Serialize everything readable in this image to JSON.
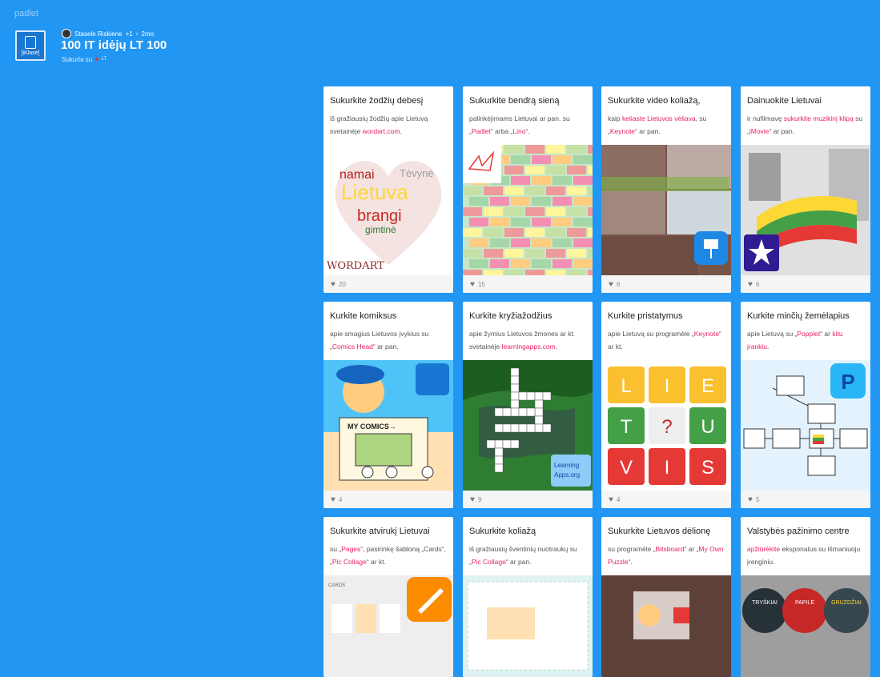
{
  "app": {
    "brand": "padlet"
  },
  "header": {
    "author": "Stasele Riskiene",
    "plus": "+1",
    "dot": "•",
    "age": "2mo",
    "title": "100 IT idėjų LT 100",
    "made_with": "Sukurta su",
    "made_lt": "LT",
    "logo_text": "[iKlasė]"
  },
  "colors": {
    "background": "#2196f3",
    "link": "#e91e63",
    "card": "#ffffff",
    "footer": "#f5f5f5"
  },
  "cards": [
    {
      "title": "Sukurkite žodžių debesį",
      "parts": [
        {
          "t": "iš gražiausių žodžių apie Lietuvą svetainėje "
        },
        {
          "t": "wordart.com",
          "link": true
        },
        {
          "t": "."
        }
      ],
      "likes": "20",
      "image": "lietuva-word-cloud-heart",
      "img_text": [
        "namai",
        "Tėvynė",
        "Lietuva",
        "brangi",
        "gimtinė",
        "WORDART"
      ]
    },
    {
      "title": "Sukurkite bendrą sieną",
      "parts": [
        {
          "t": "palinkėjimams Lietuvai ar pan. su „"
        },
        {
          "t": "Padlet",
          "link": true
        },
        {
          "t": "“ arba „"
        },
        {
          "t": "Lino",
          "link": true
        },
        {
          "t": "“."
        }
      ],
      "likes": "15",
      "image": "sticky-notes-wall",
      "img_text": []
    },
    {
      "title": "Sukurkite video koliažą,",
      "parts": [
        {
          "t": "kaip "
        },
        {
          "t": "keliaste Lietuvos vėliava",
          "link": true
        },
        {
          "t": ", su „"
        },
        {
          "t": "Keynote",
          "link": true
        },
        {
          "t": "“ ar pan."
        }
      ],
      "likes": "6",
      "image": "flag-photo-collage",
      "img_text": []
    },
    {
      "title": "Dainuokite Lietuvai",
      "parts": [
        {
          "t": "ir nufilmavę "
        },
        {
          "t": "sukurkite muzikinį klipą",
          "link": true
        },
        {
          "t": " su „"
        },
        {
          "t": "iMovie",
          "link": true
        },
        {
          "t": "“ ar pan."
        }
      ],
      "likes": "6",
      "image": "flag-ribbon-imovie",
      "img_text": []
    },
    {
      "title": "Kurkite komiksus",
      "parts": [
        {
          "t": "apie smagius Lietuvos įvykius su „"
        },
        {
          "t": "Comics Head",
          "link": true
        },
        {
          "t": "“ ar pan."
        }
      ],
      "likes": "4",
      "image": "comics-head-cartoon",
      "img_text": [
        "MY COMICS→"
      ]
    },
    {
      "title": "Kurkite kryžiažodžius",
      "parts": [
        {
          "t": "apie žymius Lietuvos žmones ar kt. svetainėje "
        },
        {
          "t": "learningapps.com",
          "link": true
        },
        {
          "t": "."
        }
      ],
      "likes": "9",
      "image": "crossword-lake",
      "img_text": [
        "Learning",
        "Apps.org"
      ]
    },
    {
      "title": "Kurkite pristatymus",
      "parts": [
        {
          "t": "apie Lietuvą su programėle „"
        },
        {
          "t": "Keynote",
          "link": true
        },
        {
          "t": "“ ar kt."
        }
      ],
      "likes": "4",
      "image": "lietuvis-tiles",
      "img_text": [
        "L",
        "I",
        "E",
        "T",
        "?",
        "U",
        "V",
        "I",
        "S"
      ]
    },
    {
      "title": "Kurkite minčių žemėlapius",
      "parts": [
        {
          "t": "apie Lietuvą su „"
        },
        {
          "t": "Popplet",
          "link": true
        },
        {
          "t": "“ ar "
        },
        {
          "t": "kitu įrankiu",
          "link": true
        },
        {
          "t": "."
        }
      ],
      "likes": "5",
      "image": "popplet-mind-map",
      "img_text": [
        "P"
      ]
    },
    {
      "title": "Sukurkite atvirukį Lietuvai",
      "parts": [
        {
          "t": "su „"
        },
        {
          "t": "Pages",
          "link": true
        },
        {
          "t": "“, pasirinkę šabloną „Cards“, „"
        },
        {
          "t": "Pic Collage",
          "link": true
        },
        {
          "t": "“ ar kt."
        }
      ],
      "likes": "",
      "image": "pages-cards",
      "img_text": [
        "CARDS"
      ]
    },
    {
      "title": "Sukurkite koliažą",
      "parts": [
        {
          "t": "iš gražiausių šventinių nuotraukų su „"
        },
        {
          "t": "Pic Collage",
          "link": true
        },
        {
          "t": "“ ar pan."
        }
      ],
      "likes": "",
      "image": "pic-collage",
      "img_text": []
    },
    {
      "title": "Sukurkite Lietuvos dėlionę",
      "parts": [
        {
          "t": "su programėle „"
        },
        {
          "t": "Bitsboard",
          "link": true
        },
        {
          "t": "“ ar „"
        },
        {
          "t": "My Own Puzzle",
          "link": true
        },
        {
          "t": "“."
        }
      ],
      "likes": "",
      "image": "puzzle-hands",
      "img_text": []
    },
    {
      "title": "Valstybės pažinimo centre",
      "parts": [
        {
          "t": "apžiūrėkite",
          "link": true
        },
        {
          "t": " eksponatus su išmaniuoju įrenginiu."
        }
      ],
      "likes": "",
      "image": "city-badges",
      "img_text": [
        "TRYŠKIAI",
        "PAPILĖ",
        "GRUZDŽIAI"
      ]
    }
  ]
}
